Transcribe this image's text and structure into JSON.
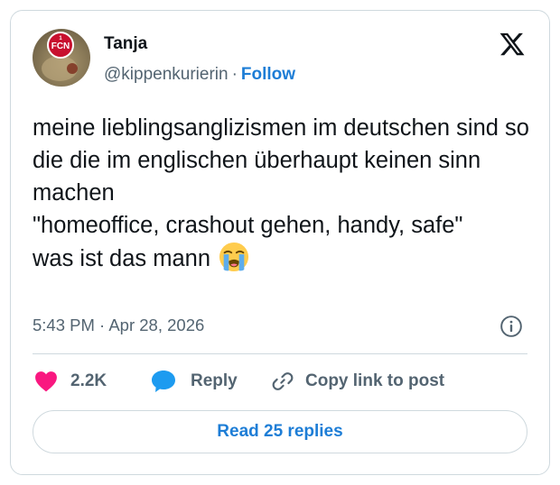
{
  "author": {
    "name": "Tanja",
    "handle": "@kippenkurierin",
    "separator": "·",
    "follow_label": "Follow",
    "avatar_badge_text": "1. FCN"
  },
  "tweet": {
    "text": "meine lieblingsanglizismen im deutschen sind so die die im englischen überhaupt keinen sinn machen\n\"homeoffice, crashout gehen, handy, safe\"\nwas ist das mann",
    "emoji": "loudly-crying-face",
    "time": "5:43 PM",
    "date": "Apr 28, 2026",
    "timestamp_separator": "·"
  },
  "actions": {
    "like_count": "2.2K",
    "reply_label": "Reply",
    "copy_link_label": "Copy link to post"
  },
  "footer": {
    "read_replies_label": "Read 25 replies"
  },
  "colors": {
    "accent": "#1d7dd6",
    "like": "#f91880",
    "reply_bubble": "#1d9bf0",
    "text_secondary": "#536471",
    "border": "#cfd9de"
  }
}
